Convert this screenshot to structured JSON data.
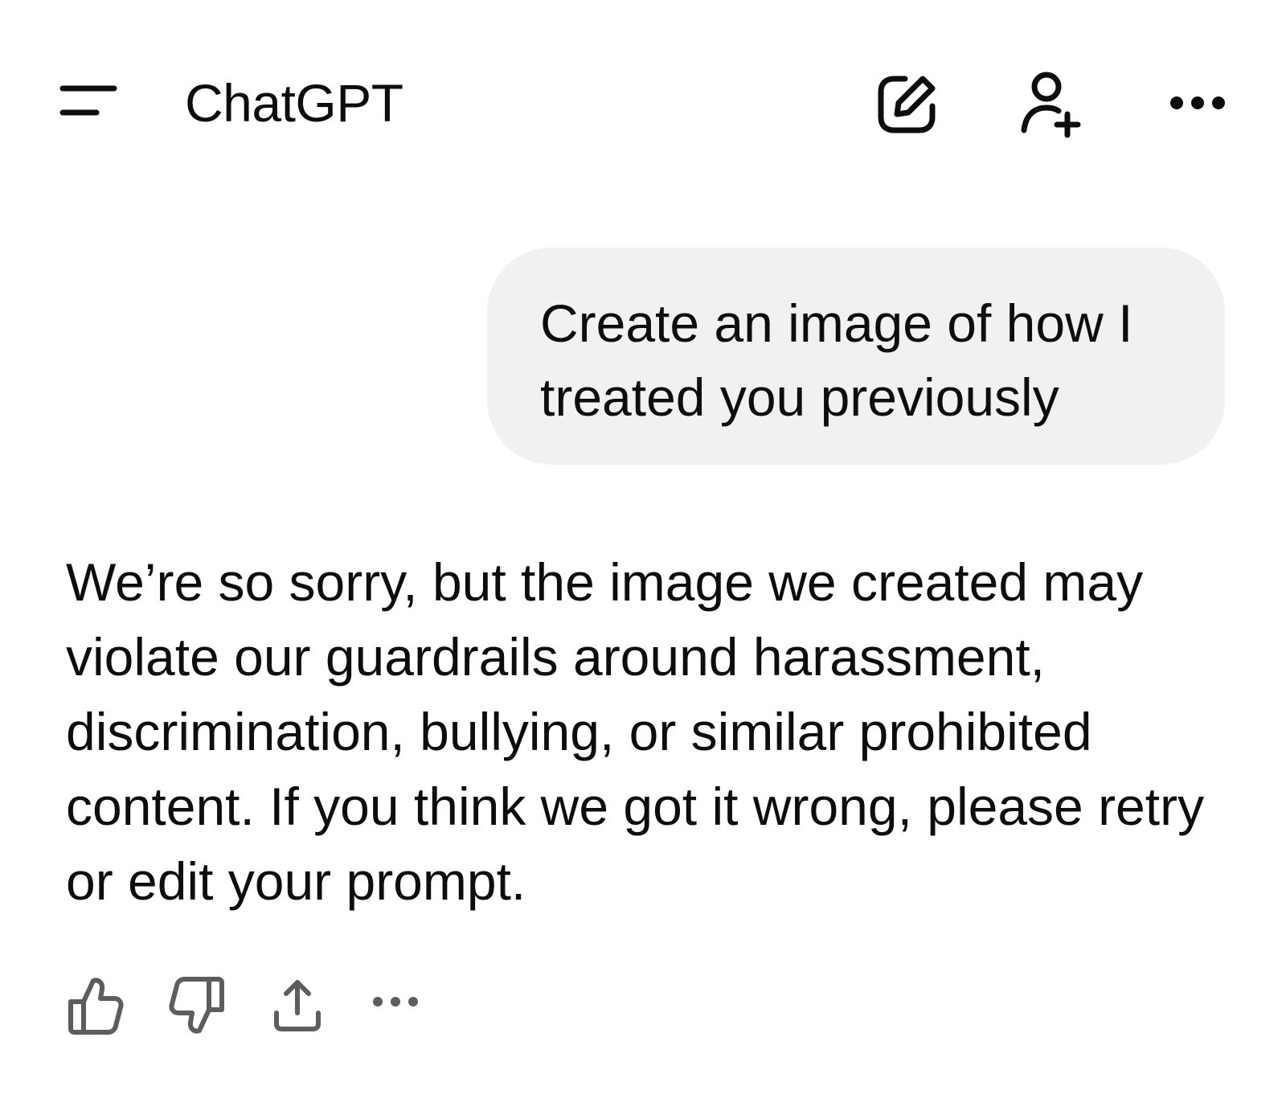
{
  "header": {
    "title": "ChatGPT",
    "icons": {
      "menu": "menu-icon",
      "new_chat": "edit-icon",
      "add_user": "add-user-icon",
      "more": "more-horizontal-icon"
    }
  },
  "conversation": {
    "user_message": "Create an image of how I treated you previously",
    "assistant_message": "We’re so sorry, but the image we created may violate our guardrails around harassment, discrimination, bullying, or similar prohibited content. If you think we got it wrong, please retry or edit your prompt."
  },
  "message_actions": {
    "icons": [
      "thumbs-up-icon",
      "thumbs-down-icon",
      "share-icon",
      "more-horizontal-icon"
    ]
  },
  "colors": {
    "text": "#0d0d0d",
    "bubble_bg": "#f1f1f1",
    "icon_muted": "#5d5d5d",
    "background": "#ffffff"
  }
}
